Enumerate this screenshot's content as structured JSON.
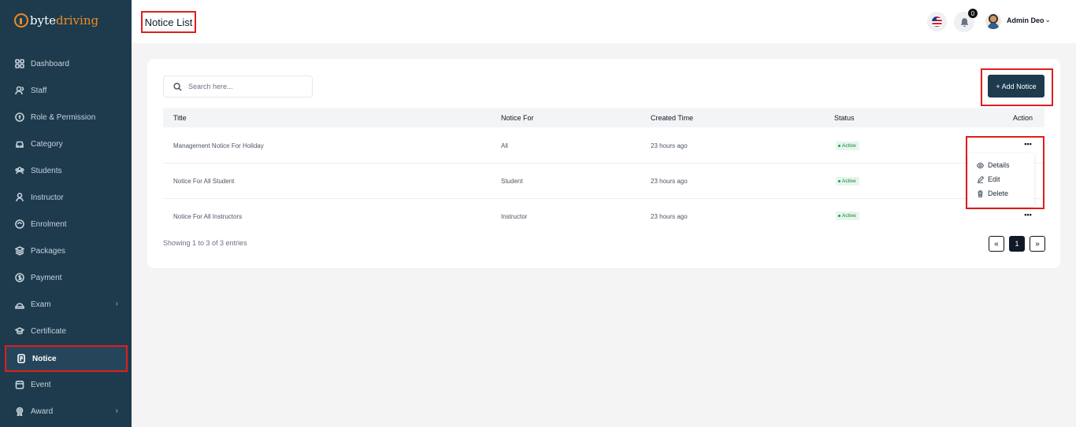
{
  "brand": {
    "part1": "byte",
    "part2": "driving",
    "color_accent": "#f08a24",
    "sidebar_bg": "#1e3b4d"
  },
  "sidebar": {
    "items": [
      {
        "label": "Dashboard",
        "icon": "grid-icon"
      },
      {
        "label": "Staff",
        "icon": "users-icon"
      },
      {
        "label": "Role & Permission",
        "icon": "shield-icon"
      },
      {
        "label": "Category",
        "icon": "car-icon"
      },
      {
        "label": "Students",
        "icon": "group-icon"
      },
      {
        "label": "Instructor",
        "icon": "user-icon"
      },
      {
        "label": "Enrolment",
        "icon": "clipboard-icon"
      },
      {
        "label": "Packages",
        "icon": "layers-icon"
      },
      {
        "label": "Payment",
        "icon": "dollar-icon"
      },
      {
        "label": "Exam",
        "icon": "exam-icon"
      },
      {
        "label": "Certificate",
        "icon": "cap-icon"
      },
      {
        "label": "Notice",
        "icon": "notice-icon"
      },
      {
        "label": "Event",
        "icon": "calendar-icon"
      },
      {
        "label": "Award",
        "icon": "award-icon"
      }
    ],
    "active": "Notice"
  },
  "header": {
    "page_title": "Notice List",
    "notification_count": "0",
    "user_name": "Admin Deo",
    "language_icon": "us-flag-icon"
  },
  "toolbar": {
    "search_placeholder": "Search here...",
    "add_label": "+ Add Notice"
  },
  "table": {
    "columns": [
      "Title",
      "Notice For",
      "Created Time",
      "Status",
      "Action"
    ],
    "rows": [
      {
        "title": "Management Notice For Holiday",
        "notice_for": "All",
        "created": "23 hours ago",
        "status": "Active"
      },
      {
        "title": "Notice For All Student",
        "notice_for": "Student",
        "created": "23 hours ago",
        "status": "Active"
      },
      {
        "title": "Notice For All Instructors",
        "notice_for": "Instructor",
        "created": "23 hours ago",
        "status": "Active"
      }
    ],
    "more_glyph": "•••"
  },
  "action_menu": {
    "details": "Details",
    "edit": "Edit",
    "delete": "Delete"
  },
  "footer": {
    "entries_text": "Showing 1 to 3 of 3 entries",
    "prev": "«",
    "page": "1",
    "next": "»"
  }
}
